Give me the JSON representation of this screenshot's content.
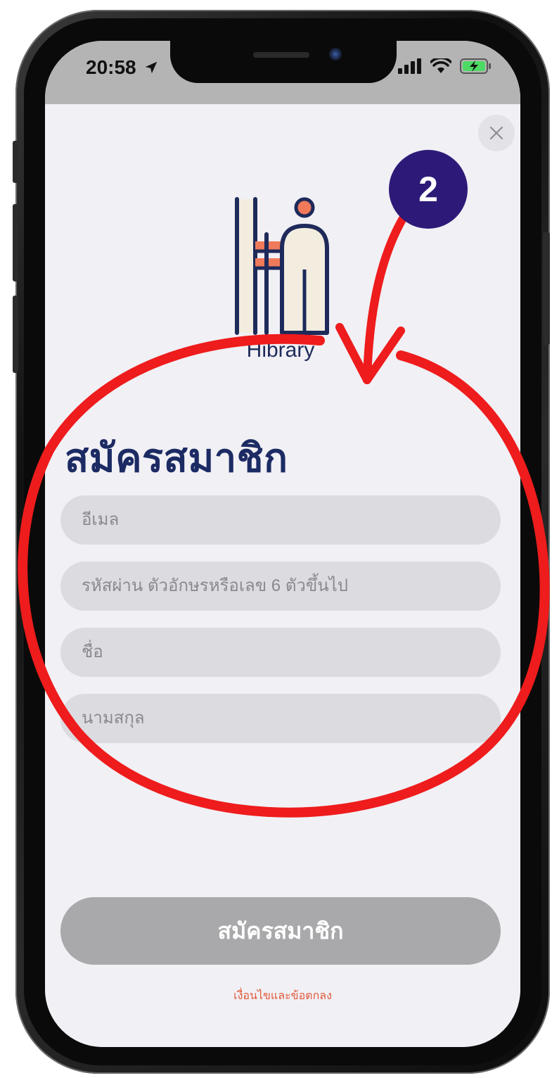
{
  "status_bar": {
    "time": "20:58"
  },
  "logo": {
    "text": "Hibrary"
  },
  "page": {
    "title": "สมัครสมาชิก"
  },
  "form": {
    "email_placeholder": "อีเมล",
    "password_placeholder": "รหัสผ่าน ตัวอักษรหรือเลข 6 ตัวขึ้นไป",
    "first_name_placeholder": "ชื่อ",
    "last_name_placeholder": "นามสกุล",
    "submit_label": "สมัครสมาชิก"
  },
  "footer": {
    "terms_label": "เงื่อนไขและข้อตกลง"
  },
  "annotation": {
    "step_number": "2",
    "color": "#ee1c1c",
    "badge_color": "#2d1a78"
  },
  "colors": {
    "title": "#1c2b63",
    "field_bg": "#dcdbe0",
    "button_bg": "#a9a9ab",
    "link": "#e05a3a",
    "sheet_bg": "#f1f0f5"
  },
  "icons": {
    "close": "close-icon",
    "location": "location-arrow-icon",
    "signal": "cellular-signal-icon",
    "wifi": "wifi-icon",
    "battery": "battery-charging-icon"
  }
}
